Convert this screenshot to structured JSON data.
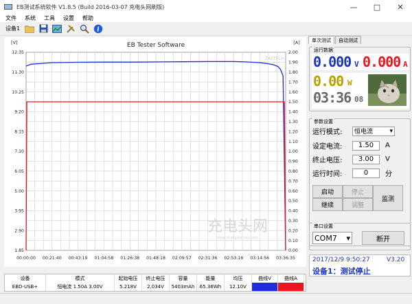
{
  "window": {
    "title": "EB测试系统软件 V1.8.5 (Build 2016-03-07 充电头网刷版)"
  },
  "menu": [
    "文件",
    "系统",
    "工具",
    "设置",
    "帮助"
  ],
  "toolbar": {
    "device_label": "设备1"
  },
  "chart": {
    "y_left_unit": "[V]",
    "y_right_unit": "[A]",
    "watermark_corner": "ZKETECH",
    "watermark_brand": "充电头网",
    "watermark_url": "www.chongdiantou.com"
  },
  "chart_data": {
    "type": "line",
    "title": "EB Tester Software",
    "x_ticks": [
      "00:00:00",
      "00:21:40",
      "00:43:19",
      "01:04:58",
      "01:26:38",
      "01:48:18",
      "02:09:57",
      "02:31:36",
      "02:53:16",
      "03:14:56",
      "03:36:35"
    ],
    "y_left_ticks": [
      "12.35",
      "11.30",
      "10.25",
      "9.20",
      "8.15",
      "7.10",
      "6.05",
      "5.00",
      "3.95",
      "2.90",
      "1.85"
    ],
    "y_right_ticks": [
      "2.00",
      "1.90",
      "1.80",
      "1.70",
      "1.60",
      "1.50",
      "1.40",
      "1.30",
      "1.20",
      "1.10",
      "1.00",
      "0.90",
      "0.80",
      "0.70",
      "0.60",
      "0.50",
      "0.40",
      "0.30",
      "0.20",
      "0.10",
      "0.00"
    ],
    "ylim_left": [
      1.85,
      12.35
    ],
    "ylim_right": [
      0,
      2.0
    ],
    "grid": true,
    "series": [
      {
        "name": "曲线V",
        "color": "#1f2cd8",
        "axis": "left",
        "x": [
          0,
          0.02,
          0.05,
          0.1,
          0.2,
          0.3,
          0.4,
          0.5,
          0.6,
          0.7,
          0.75,
          0.8,
          0.85,
          0.9,
          0.93,
          0.95,
          0.97,
          0.98,
          0.99,
          1.0
        ],
        "values": [
          11.62,
          11.72,
          11.75,
          11.8,
          11.82,
          11.83,
          11.83,
          11.84,
          11.85,
          11.86,
          11.86,
          11.86,
          11.84,
          11.8,
          11.75,
          11.7,
          11.6,
          11.45,
          11.1,
          1.85
        ]
      },
      {
        "name": "曲线A",
        "color": "#e8161e",
        "axis": "right",
        "x": [
          0,
          0.003,
          0.006,
          0.995,
          1.0
        ],
        "values": [
          0,
          1.5,
          1.5,
          1.5,
          0
        ]
      }
    ]
  },
  "table": {
    "headers": [
      "设备",
      "模式",
      "起始电压",
      "终止电压",
      "容量",
      "能量",
      "均压",
      "曲线V",
      "曲线A"
    ],
    "row": [
      "EBD-USB+",
      "恒电流 1.50A 3.00V",
      "5.218V",
      "2.034V",
      "5403mAh",
      "65.36Wh",
      "12.10V",
      "",
      ""
    ],
    "colors": {
      "v": "#1f2cd8",
      "a": "#e8161e"
    }
  },
  "right": {
    "tabs": [
      "单次测试",
      "自动测试"
    ],
    "run_data_title": "运行数据",
    "voltage": "0.000",
    "voltage_unit": "V",
    "current": "0.000",
    "current_unit": "A",
    "power": "0.00",
    "power_unit": "W",
    "time_main": "03:36",
    "time_sec": "08",
    "params_title": "参数设置",
    "mode_label": "运行模式:",
    "mode_value": "恒电流",
    "set_current_label": "设定电流:",
    "set_current_value": "1.50",
    "set_current_unit": "A",
    "end_voltage_label": "终止电压:",
    "end_voltage_value": "3.00",
    "end_voltage_unit": "V",
    "run_time_label": "运行时间:",
    "run_time_value": "0",
    "run_time_unit": "分",
    "btn_start": "启动",
    "btn_stop": "停止",
    "btn_monitor": "监测",
    "btn_continue": "继续",
    "btn_adjust": "调整",
    "serial_title": "串口设置",
    "com_value": "COM7",
    "btn_disconnect": "断开",
    "status_time": "2017/12/9 9:50:27",
    "status_version": "V3.20",
    "status_text": "设备1：测试停止"
  }
}
